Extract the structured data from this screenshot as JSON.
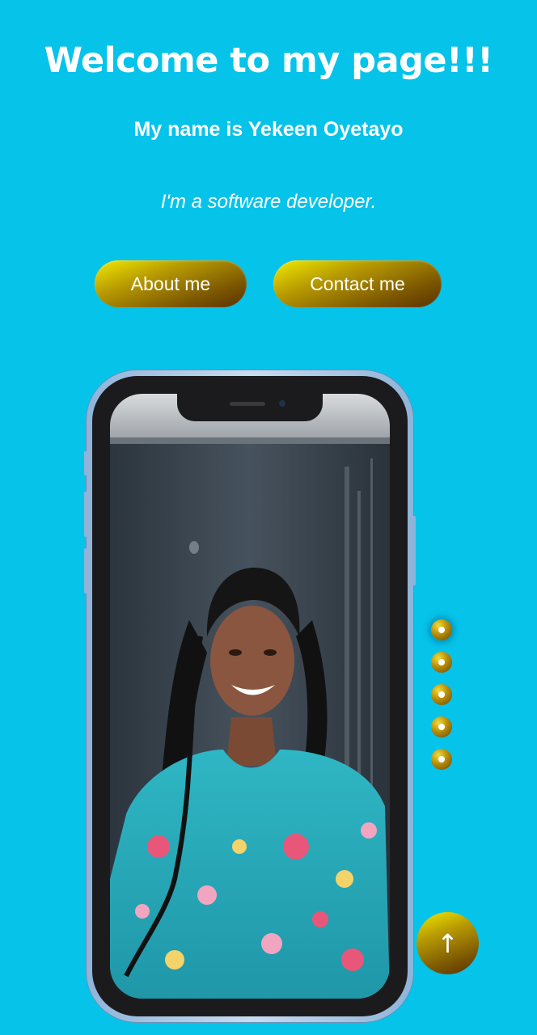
{
  "hero": {
    "title": "Welcome to my page!!!",
    "name_line": "My name is Yekeen Oyetayo",
    "tagline": "I'm a software developer."
  },
  "buttons": {
    "about": "About me",
    "contact": "Contact me"
  },
  "scroll_top": {
    "icon": "arrow-up-icon",
    "glyph": "↑"
  },
  "section_dots": {
    "count": 5,
    "active_index": 0
  },
  "colors": {
    "background": "#06c3ea",
    "button_gold_light": "#f2ea00",
    "button_gold_dark": "#5a3200",
    "text": "#ffffff"
  }
}
